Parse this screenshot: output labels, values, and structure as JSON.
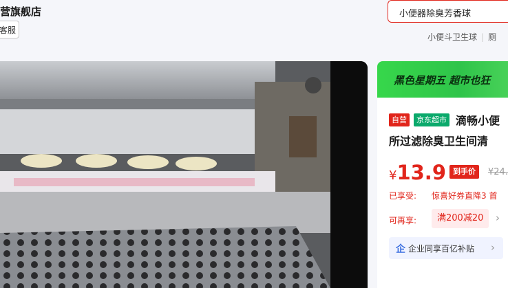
{
  "header": {
    "store_name": "营旗舰店",
    "customer_service": "客服"
  },
  "search": {
    "value": "小便器除臭芳香球"
  },
  "hot_words": [
    "小便斗卫生球",
    "厕"
  ],
  "media": {
    "description_alt": "product video frame"
  },
  "promo_banner": {
    "text": "黑色星期五 超市也狂"
  },
  "product": {
    "badge_self": "自营",
    "badge_market": "京东超市",
    "title_line1": "滴畅小便",
    "title_line2": "所过滤除臭卫生间清",
    "currency": "¥",
    "price": "13.9",
    "price_tag": "到手价",
    "original_price": "¥24.",
    "enjoyed_label": "已享受:",
    "enjoyed_text": "惊喜好券直降3 首",
    "more_label": "可再享:",
    "coupon": "满200减20",
    "enterprise": "企业同享百亿补贴"
  },
  "colors": {
    "accent": "#e1251b",
    "green": "#0aa96b",
    "banner": "#37d74b"
  }
}
